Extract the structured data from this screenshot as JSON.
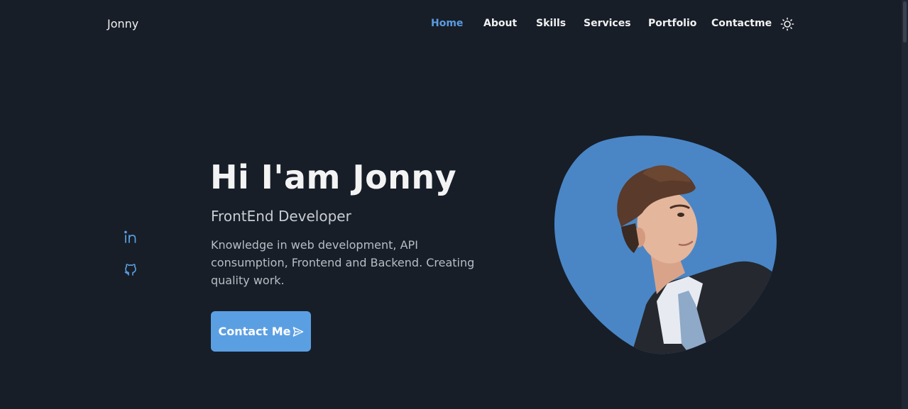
{
  "header": {
    "logo": "Jonny",
    "nav": [
      {
        "label": "Home"
      },
      {
        "label": "About"
      },
      {
        "label": "Skills"
      },
      {
        "label": "Services"
      },
      {
        "label": "Portfolio"
      },
      {
        "label": "Contactme"
      }
    ],
    "active_nav": "Home",
    "theme_icon": "sun-icon"
  },
  "social": [
    {
      "icon": "linkedin-icon"
    },
    {
      "icon": "github-icon"
    }
  ],
  "hero": {
    "title": "Hi I'am Jonny",
    "subtitle": "FrontEnd Developer",
    "description": "Knowledge in web development, API consumption, Frontend and Backend. Creating quality work.",
    "button_label": "Contact Me",
    "button_icon": "send-icon"
  },
  "colors": {
    "background": "#171e28",
    "accent": "#5b9fe3",
    "active_nav": "#5a9be0",
    "blob": "#4a86c6",
    "text": "#f1f1f1"
  }
}
